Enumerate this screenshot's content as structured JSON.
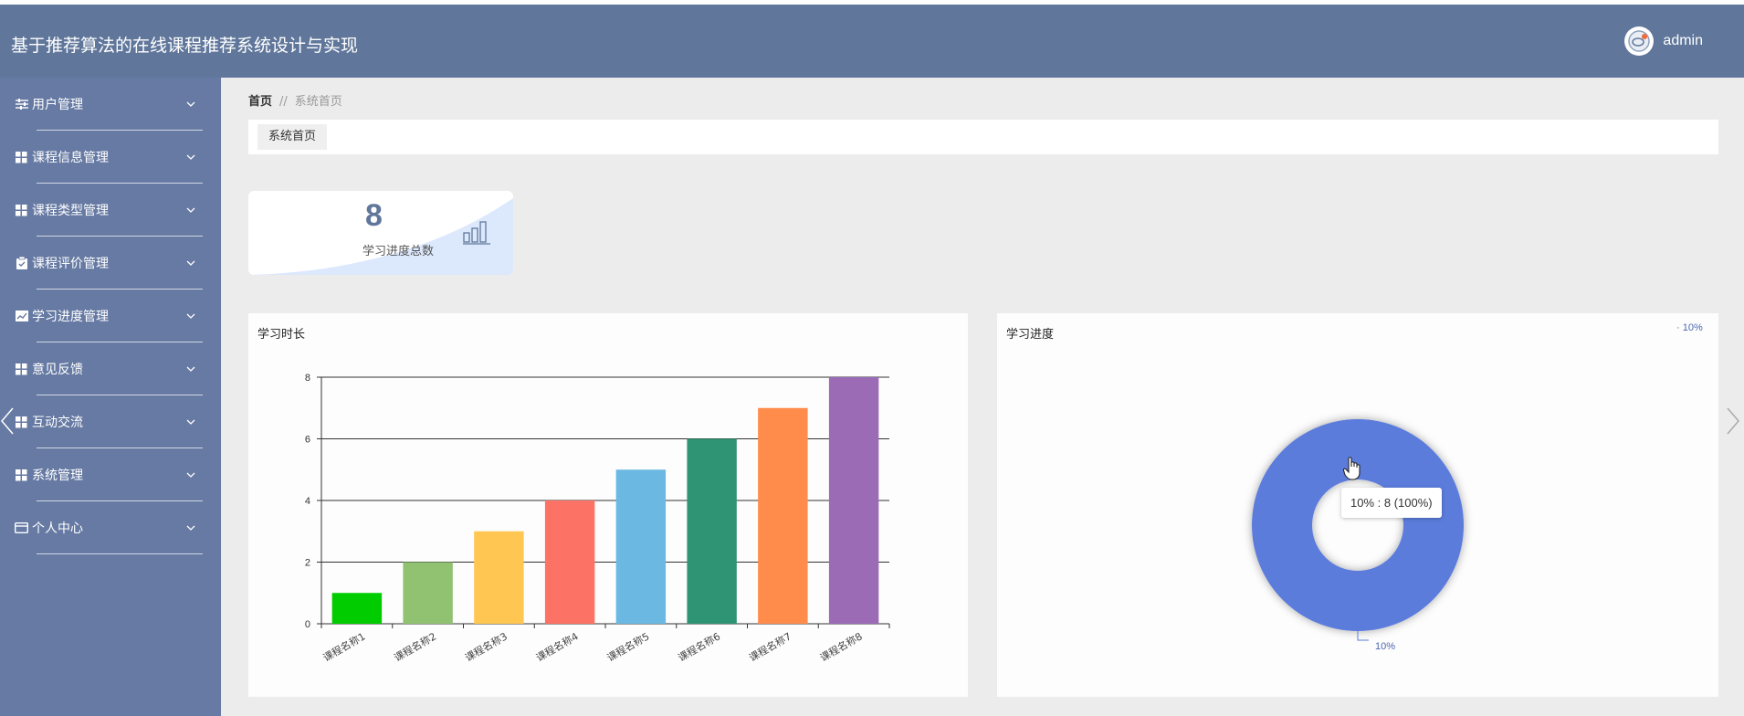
{
  "app": {
    "title": "基于推荐算法的在线课程推荐系统设计与实现",
    "username": "admin"
  },
  "sidebar": {
    "items": [
      {
        "label": "用户管理",
        "icon": "sliders-icon"
      },
      {
        "label": "课程信息管理",
        "icon": "grid-icon"
      },
      {
        "label": "课程类型管理",
        "icon": "grid-icon"
      },
      {
        "label": "课程评价管理",
        "icon": "clipboard-icon"
      },
      {
        "label": "学习进度管理",
        "icon": "trend-icon"
      },
      {
        "label": "意见反馈",
        "icon": "grid-icon"
      },
      {
        "label": "互动交流",
        "icon": "grid-icon"
      },
      {
        "label": "系统管理",
        "icon": "grid-icon"
      },
      {
        "label": "个人中心",
        "icon": "card-icon"
      }
    ]
  },
  "breadcrumb": {
    "home": "首页",
    "separator": "//",
    "current": "系统首页"
  },
  "tabs": [
    {
      "label": "系统首页"
    }
  ],
  "stat": {
    "value": "8",
    "label": "学习进度总数"
  },
  "colors": {
    "topbar": "#60779b",
    "sidebar": "#667aa3",
    "accent": "#60779b",
    "pie": "#5b7bdc"
  },
  "chart_data": [
    {
      "type": "bar",
      "title": "学习时长",
      "categories": [
        "课程名称1",
        "课程名称2",
        "课程名称3",
        "课程名称4",
        "课程名称5",
        "课程名称6",
        "课程名称7",
        "课程名称8"
      ],
      "values": [
        1,
        2,
        3,
        4,
        5,
        6,
        7,
        8
      ],
      "colors": [
        "#00cc00",
        "#90c271",
        "#ffc751",
        "#fc7264",
        "#6bb8e2",
        "#2f9474",
        "#ff8c4a",
        "#9c6bb6"
      ],
      "yticks": [
        "0",
        "2",
        "4",
        "6",
        "8"
      ],
      "ylim": [
        0,
        8
      ],
      "grid": true
    },
    {
      "type": "pie",
      "title": "学习进度",
      "labels": [
        "10%"
      ],
      "values": [
        8
      ],
      "legend": [
        "10%"
      ],
      "legend_position": "top-right",
      "slice_label": "10%",
      "tooltip": "10% : 8 (100%)"
    }
  ]
}
